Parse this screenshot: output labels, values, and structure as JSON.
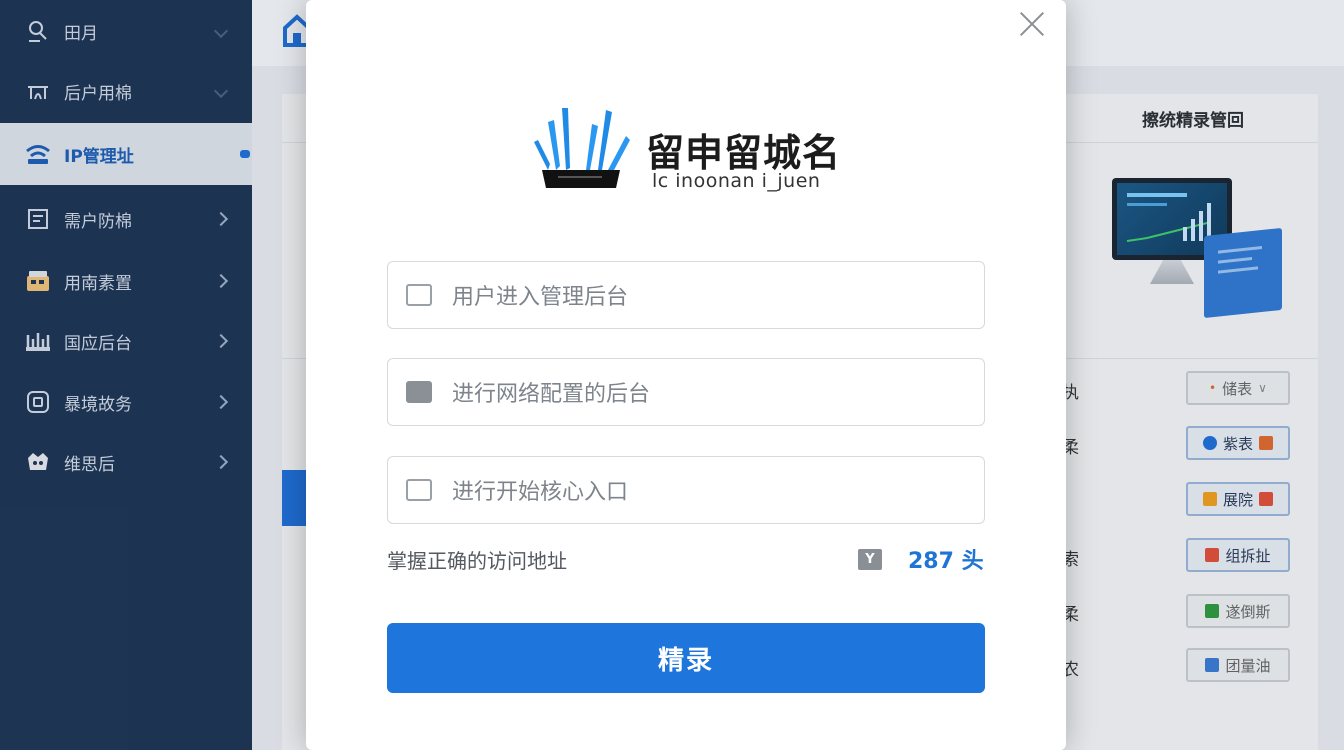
{
  "sidebar": {
    "items": [
      {
        "icon": "user-search-icon",
        "label": "田月"
      },
      {
        "icon": "tent-icon",
        "label": "后户用棉"
      },
      {
        "icon": "wifi-icon",
        "label": "IP管理址"
      },
      {
        "icon": "window-icon",
        "label": "需户防棉"
      },
      {
        "icon": "store-icon",
        "label": "用南素置"
      },
      {
        "icon": "router-icon",
        "label": "国应后台"
      },
      {
        "icon": "screen-icon",
        "label": "暴境故务"
      },
      {
        "icon": "gift-icon",
        "label": "维思后"
      }
    ]
  },
  "background": {
    "right_panel_title": "擦统精录管回",
    "rows": [
      {
        "label": "执",
        "button": "储表",
        "button_icon_color": "#e06a2f"
      },
      {
        "label": "柔",
        "button": "紫表",
        "button_icon_color": "#1e6fd9"
      },
      {
        "label": "",
        "button": "展院",
        "button_icon_color": "#f0a020"
      },
      {
        "label": "索",
        "button": "组拆扯",
        "button_icon_color": "#e0503a"
      },
      {
        "label": "柔",
        "button": "遂倒斯",
        "button_icon_color": "#2e9a3e"
      },
      {
        "label": "农",
        "button": "团量油",
        "button_icon_color": "#3a7bd5"
      }
    ]
  },
  "modal": {
    "brand_title": "留申留城名",
    "brand_subtitle": "lc inoonan i_juen",
    "fields": [
      {
        "icon": "id-card-icon",
        "placeholder": "用户进入管理后台"
      },
      {
        "icon": "user-icon",
        "placeholder": "进行网络配置的后台"
      },
      {
        "icon": "image-icon",
        "placeholder": "进行开始核心入口"
      }
    ],
    "hint_text": "掌握正确的访问地址",
    "hint_icon_text": "Y",
    "hint_count": "287 头",
    "login_label": "精录"
  },
  "colors": {
    "sidebar_bg": "#1c3454",
    "accent": "#1e76dc",
    "active_text": "#1e5fb8"
  }
}
